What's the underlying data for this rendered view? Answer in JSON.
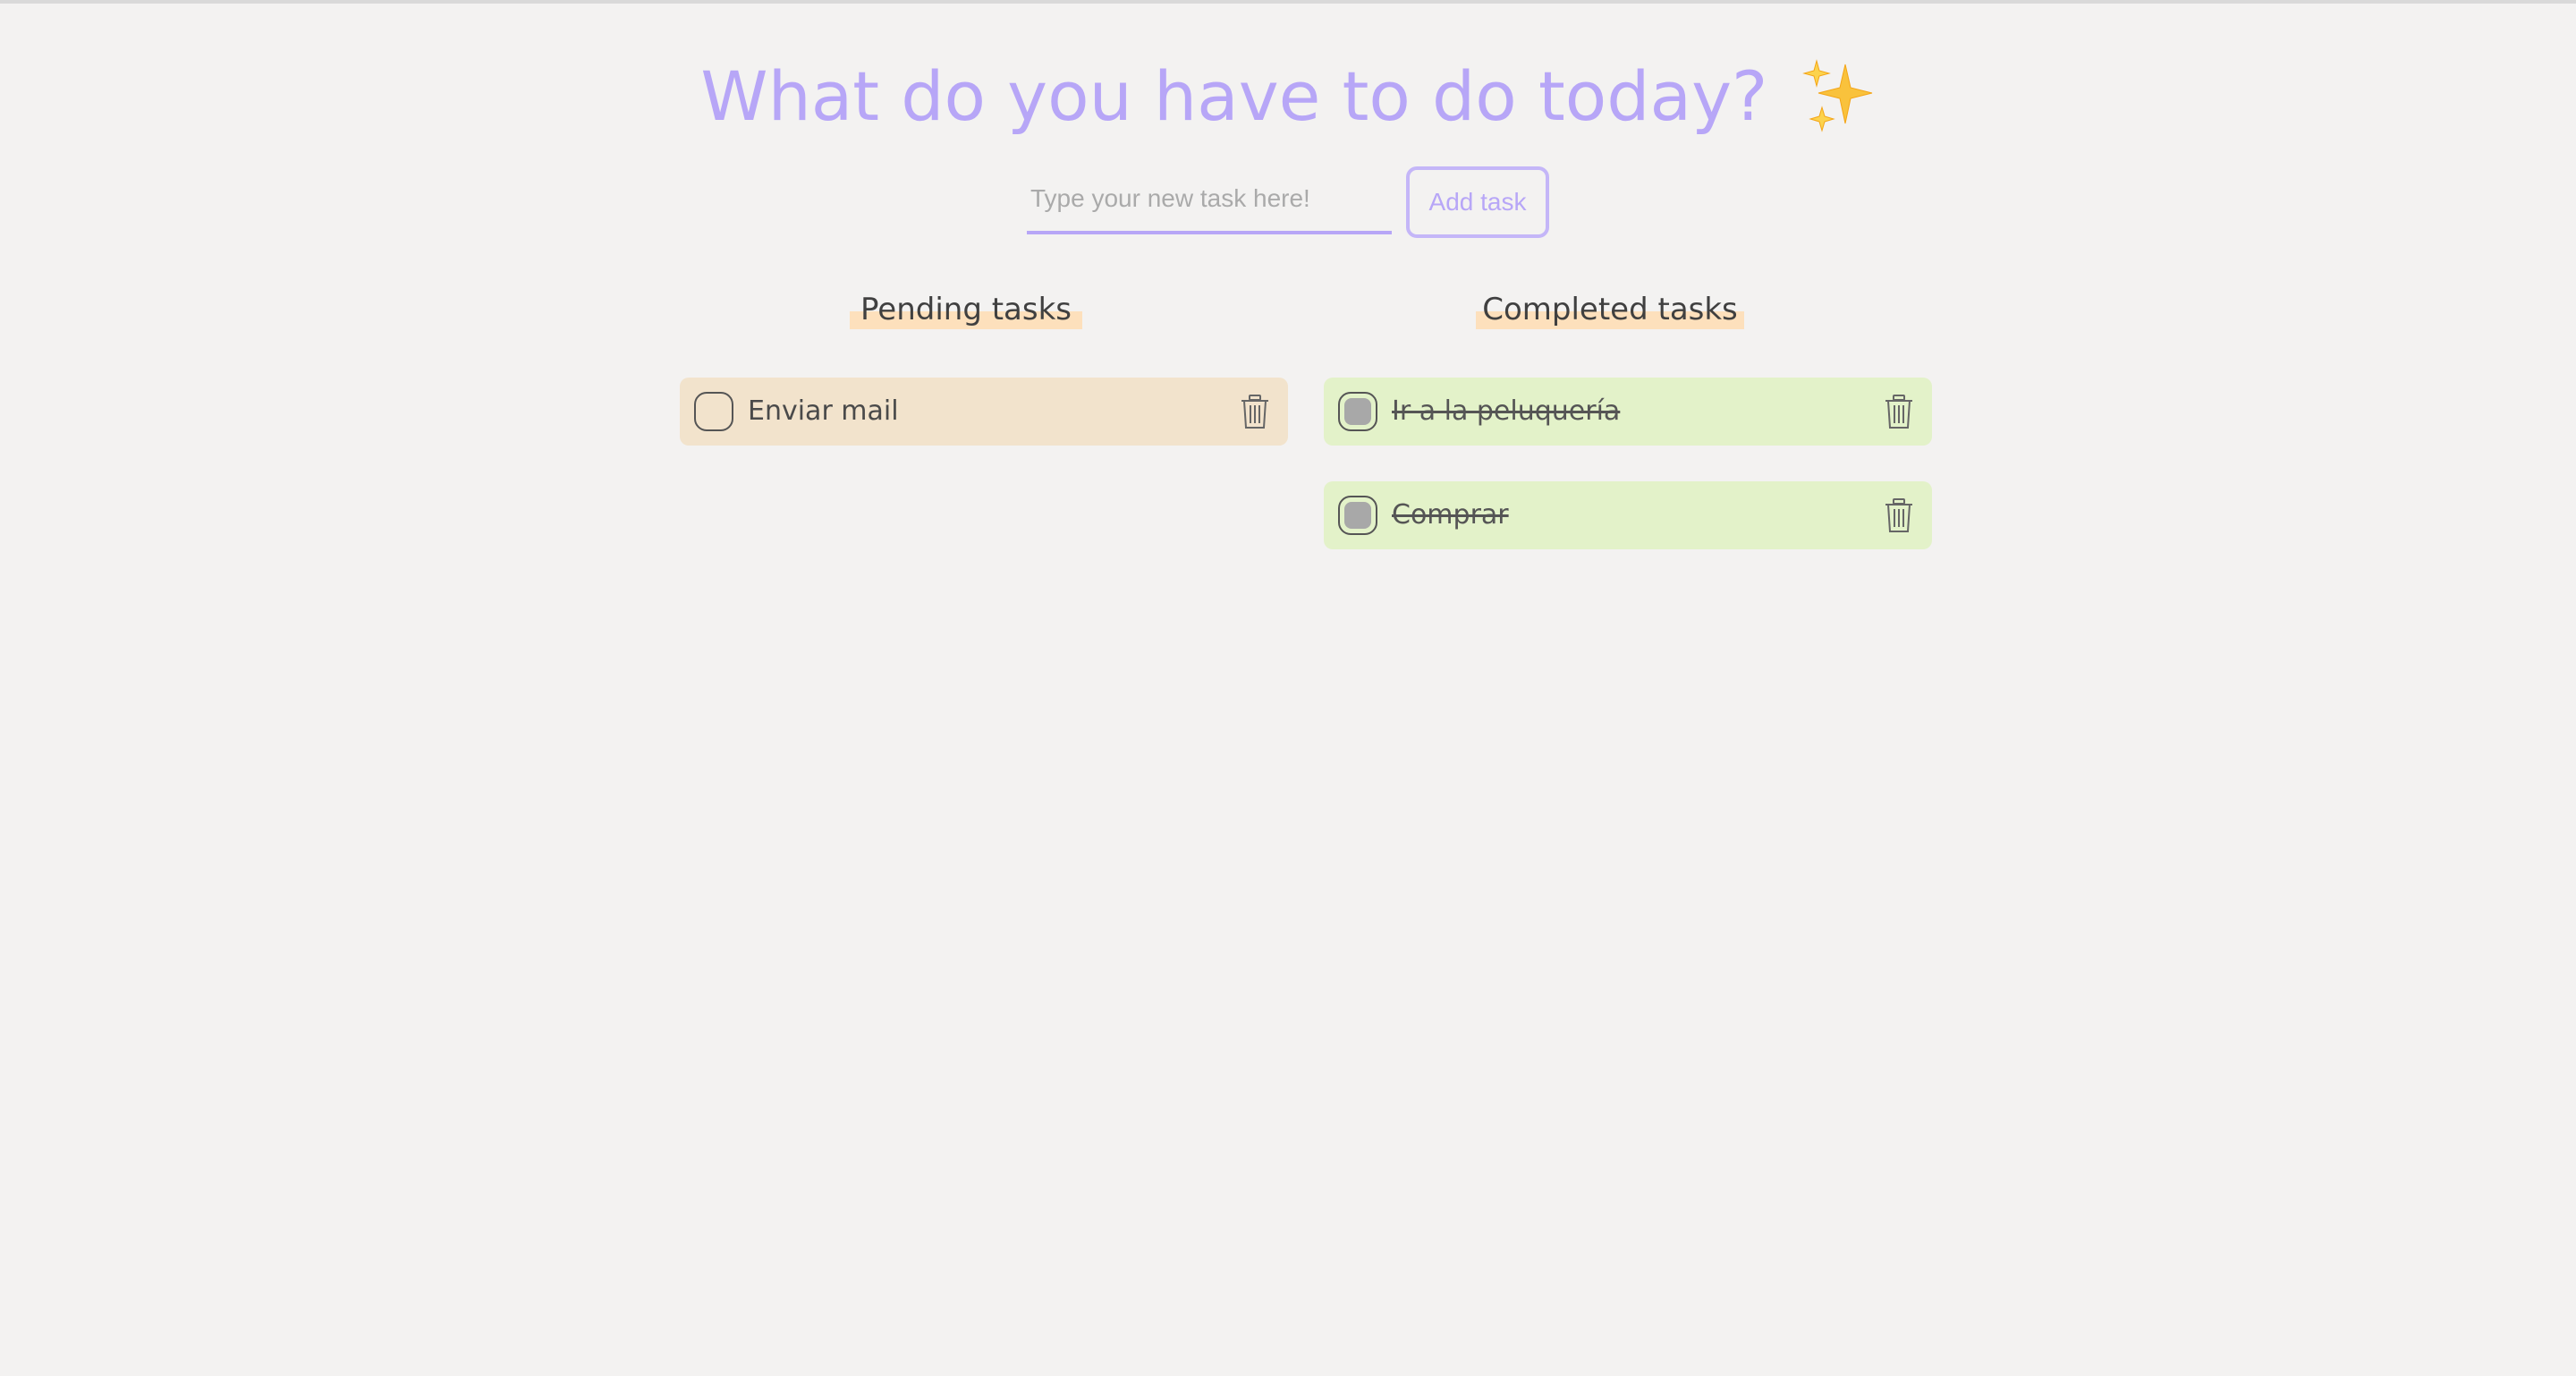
{
  "app": {
    "title": "What do you have to do today?",
    "title_emoji_icon": "sparkles-icon"
  },
  "form": {
    "input_placeholder": "Type your new task here!",
    "input_value": "",
    "add_button_label": "Add task"
  },
  "columns": {
    "pending_heading": "Pending tasks",
    "completed_heading": "Completed tasks"
  },
  "pending_tasks": [
    {
      "label": "Enviar mail",
      "completed": false
    }
  ],
  "completed_tasks": [
    {
      "label": "Ir a la peluquería",
      "completed": true
    },
    {
      "label": "Comprar",
      "completed": true
    }
  ],
  "colors": {
    "accent": "#b7a6f7",
    "pending_card": "#f2e3cc",
    "completed_card": "#e3f2c9",
    "heading_highlight": "#fde0bc",
    "background": "#f3f2f1"
  }
}
